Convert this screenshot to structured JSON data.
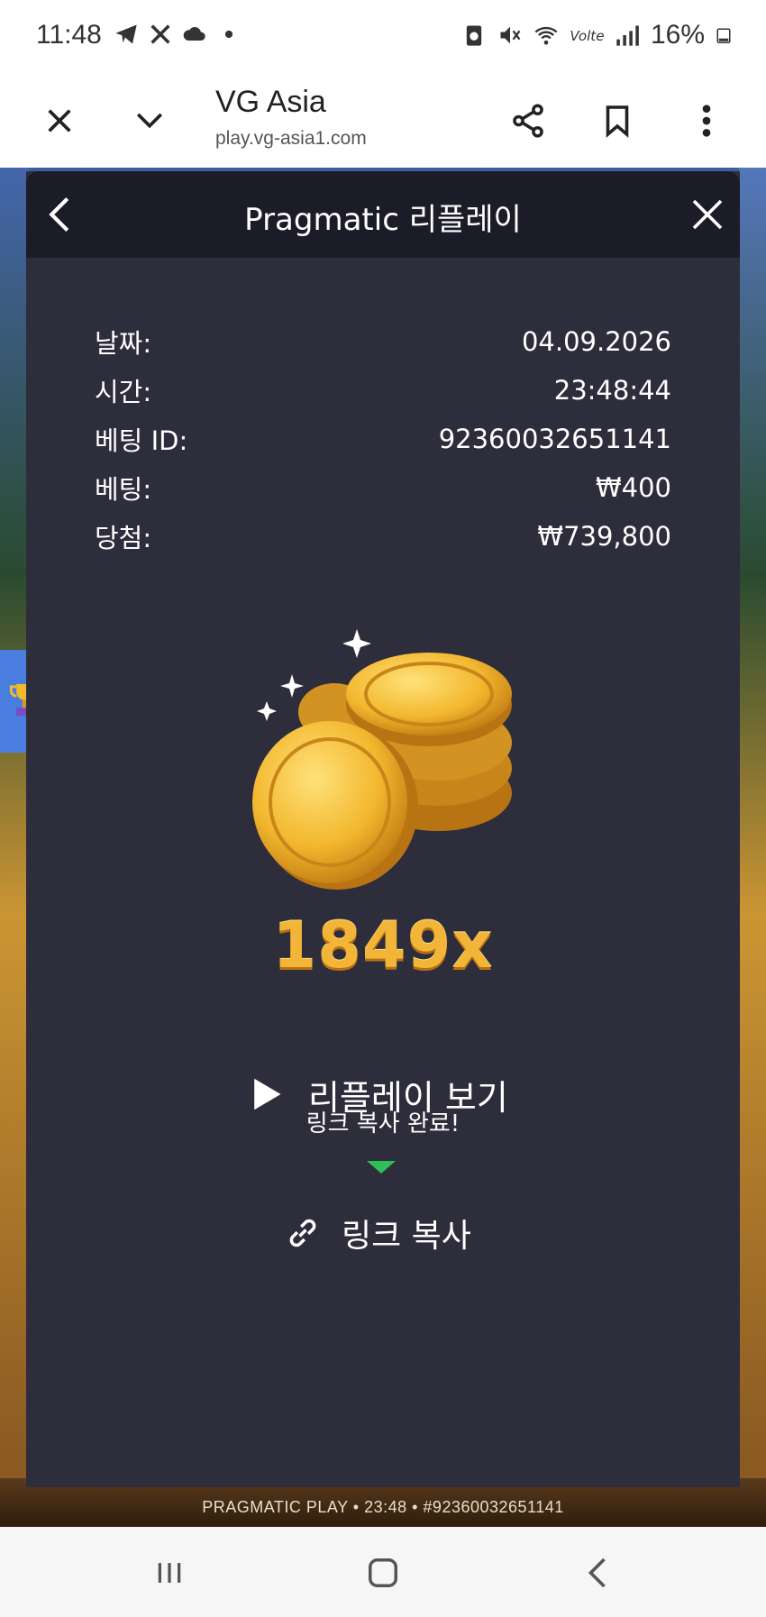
{
  "status_bar": {
    "time": "11:48",
    "left_icons": [
      "telegram-icon",
      "tools-icon",
      "cloud-icon",
      "dot-icon"
    ],
    "right_icons": [
      "battery-saver-icon",
      "mute-icon",
      "wifi-icon",
      "volte-icon",
      "signal-icon"
    ],
    "battery_percent": "16%"
  },
  "browser": {
    "title": "VG Asia",
    "url": "play.vg-asia1.com"
  },
  "modal": {
    "title": "Pragmatic 리플레이",
    "rows": [
      {
        "label": "날짜:",
        "value": "04.09.2026"
      },
      {
        "label": "시간:",
        "value": "23:48:44"
      },
      {
        "label": "베팅 ID:",
        "value": "92360032651141"
      },
      {
        "label": "베팅:",
        "value": "₩400"
      },
      {
        "label": "당첨:",
        "value": "₩739,800"
      }
    ],
    "multiplier": "1849x",
    "replay_label": "리플레이 보기",
    "toast": "링크 복사 완료!",
    "copy_label": "링크 복사"
  },
  "game_footer": "PRAGMATIC PLAY • 23:48 • #92360032651141",
  "colors": {
    "modal_bg": "#2d2d3b",
    "header_bg": "#1b1c27",
    "gold": "#f3b537",
    "toast_arrow": "#2fbf57"
  }
}
